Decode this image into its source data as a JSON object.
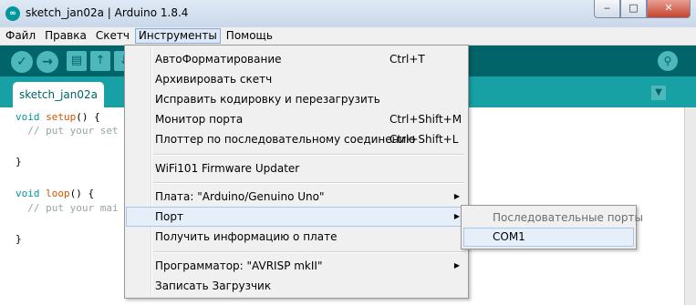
{
  "window": {
    "title": "sketch_jan02a | Arduino 1.8.4",
    "app_icon": "arduino-logo-icon",
    "controls": {
      "minimize": "‒",
      "maximize": "□",
      "close": "✕"
    }
  },
  "menubar": {
    "items": [
      "Файл",
      "Правка",
      "Скетч",
      "Инструменты",
      "Помощь"
    ],
    "active": "Инструменты"
  },
  "toolbar": {
    "buttons": [
      "verify-icon",
      "upload-icon",
      "new-icon",
      "open-icon",
      "save-icon"
    ],
    "serial_monitor": "serial-monitor-icon"
  },
  "tabs": {
    "active_label": "sketch_jan02a"
  },
  "editor": {
    "lines": [
      "void setup() {",
      "  // put your setup code here, to run once:",
      "",
      "}",
      "",
      "void loop() {",
      "  // put your main code here, to run repeatedly:",
      "",
      "}"
    ],
    "visible": {
      "l1_kw": "void",
      "l1_fn": "setup",
      "l1_rest": "() {",
      "l2": "  // put your set",
      "l4": "}",
      "l6_kw": "void",
      "l6_fn": "loop",
      "l6_rest": "() {",
      "l7": "  // put your mai",
      "l9": "}"
    }
  },
  "tools_menu": {
    "items": [
      {
        "label": "АвтоФорматирование",
        "shortcut": "Ctrl+T"
      },
      {
        "label": "Архивировать скетч"
      },
      {
        "label": "Исправить кодировку и перезагрузить"
      },
      {
        "label": "Монитор порта",
        "shortcut": "Ctrl+Shift+M"
      },
      {
        "label": "Плоттер по последовательному соединению",
        "shortcut": "Ctrl+Shift+L"
      },
      {
        "label": "WiFi101 Firmware Updater"
      },
      {
        "label": "Плата: \"Arduino/Genuino Uno\"",
        "submenu": true
      },
      {
        "label": "Порт",
        "submenu": true,
        "highlighted": true
      },
      {
        "label": "Получить информацию о плате"
      },
      {
        "label": "Программатор: \"AVRISP mkII\"",
        "submenu": true
      },
      {
        "label": "Записать Загрузчик"
      }
    ]
  },
  "port_submenu": {
    "header": "Последовательные порты",
    "items": [
      "COM1"
    ],
    "highlighted": "COM1"
  }
}
